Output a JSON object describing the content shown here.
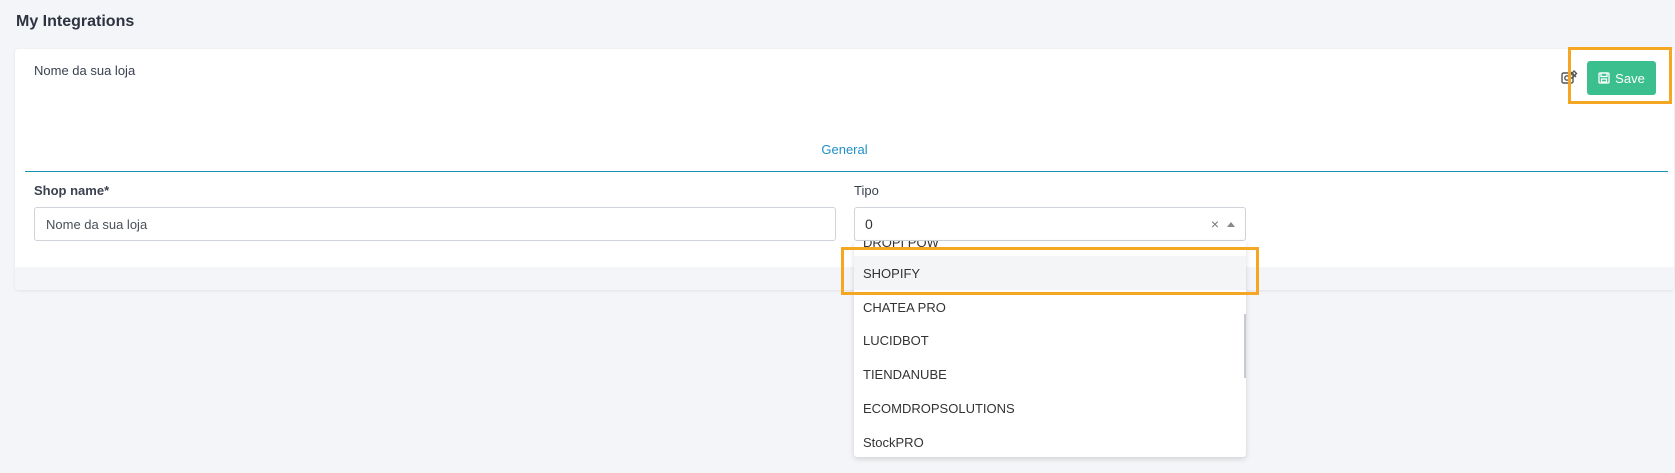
{
  "page": {
    "title": "My Integrations"
  },
  "card": {
    "header_name": "Nome da sua loja",
    "save_label": "Save",
    "tab_general": "General"
  },
  "form": {
    "shop_name_label": "Shop name*",
    "shop_name_value": "Nome da sua loja",
    "tipo_label": "Tipo",
    "tipo_value": "0",
    "clear_symbol": "×"
  },
  "dropdown": {
    "partial_item": "DROPI POW",
    "items": [
      "SHOPIFY",
      "CHATEA PRO",
      "LUCIDBOT",
      "TIENDANUBE",
      "ECOMDROPSOLUTIONS",
      "StockPRO"
    ]
  },
  "colors": {
    "save": "#3cbf8f",
    "accent": "#1e90c8",
    "highlight": "#f5a623"
  },
  "icons": {
    "save": "floppy-disk-icon",
    "edit": "edit-image-icon",
    "clear": "close-icon",
    "caret": "caret-up-icon"
  }
}
